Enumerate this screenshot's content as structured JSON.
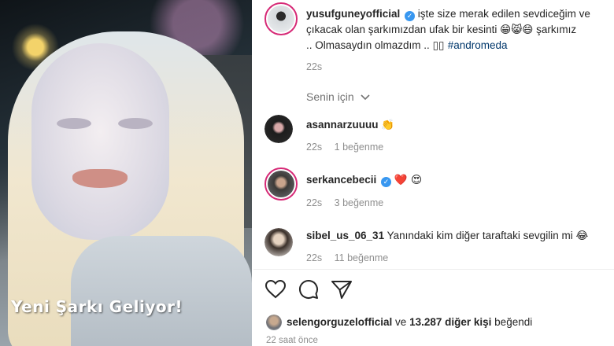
{
  "media": {
    "caption": "Yeni Şarkı Geliyor!"
  },
  "post": {
    "username": "yusufguneyofficial",
    "caption_line1": "işte size merak edilen sevdiceğim ve",
    "caption_line2": "çıkacak olan şarkımızdan ufak bir kesinti",
    "caption_line2_tail": "şarkımız",
    "caption_line3": ".. Olmasaydın olmazdım .. ",
    "hashtag": "#andromeda",
    "time": "22s"
  },
  "for_you": {
    "label": "Senin için"
  },
  "comments": [
    {
      "username": "asannarzuuuu",
      "text": "",
      "emoji": "👏",
      "time": "22s",
      "likes": "1 beğenme",
      "verified": false
    },
    {
      "username": "serkancebecii",
      "text": "",
      "emoji": "❤️ 😍",
      "time": "22s",
      "likes": "3 beğenme",
      "verified": true
    },
    {
      "username": "sibel_us_06_31",
      "text": "Yanındaki kim diğer taraftaki sevgilin mi",
      "emoji": "😂",
      "time": "22s",
      "likes": "11 beğenme",
      "verified": false
    }
  ],
  "actions": {
    "like": "heart-icon",
    "comment": "comment-icon",
    "share": "share-icon"
  },
  "likes_summary": {
    "user": "selengorguzelofficial",
    "connector": "ve",
    "others": "13.287 diğer kişi",
    "verb": "beğendi"
  },
  "timestamp": "22 saat önce",
  "colors": {
    "accent": "#3897f0",
    "hashtag": "#00376b",
    "muted": "#8e8e8e",
    "story_ring": "#d62976"
  }
}
